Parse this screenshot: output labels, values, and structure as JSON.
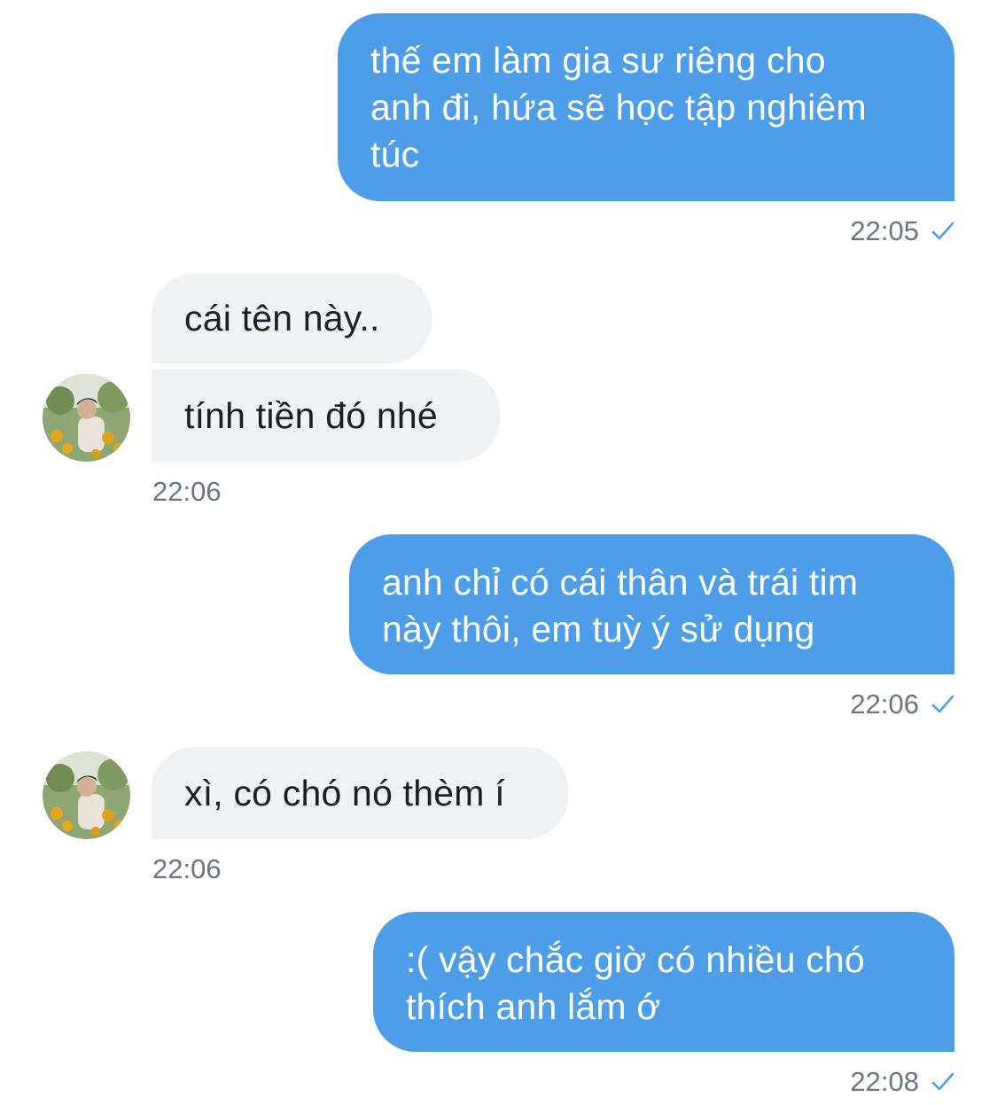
{
  "colors": {
    "sent_bubble": "#4d9de8",
    "received_bubble": "#eff1f4",
    "timestamp": "#687684",
    "read_check": "#4d9de8"
  },
  "messages": [
    {
      "direction": "sent",
      "lines": [
        "thế em làm gia sư riêng cho",
        "anh đi, hứa sẽ học tập nghiêm",
        "túc"
      ],
      "time": "22:05",
      "status_icon": "check-icon"
    },
    {
      "direction": "received",
      "lines": [
        "cái tên này.."
      ]
    },
    {
      "direction": "received",
      "lines": [
        "tính tiền đó nhé"
      ],
      "time": "22:06",
      "avatar": "avatar-icon"
    },
    {
      "direction": "sent",
      "lines": [
        "anh chỉ có cái thân và trái tim",
        "này thôi, em tuỳ ý sử dụng"
      ],
      "time": "22:06",
      "status_icon": "check-icon"
    },
    {
      "direction": "received",
      "lines": [
        "xì, có chó nó thèm í"
      ],
      "time": "22:06",
      "avatar": "avatar-icon"
    },
    {
      "direction": "sent",
      "lines": [
        ":( vậy chắc giờ có nhiều chó",
        "thích anh lắm ớ"
      ],
      "time": "22:08",
      "status_icon": "check-icon"
    }
  ]
}
